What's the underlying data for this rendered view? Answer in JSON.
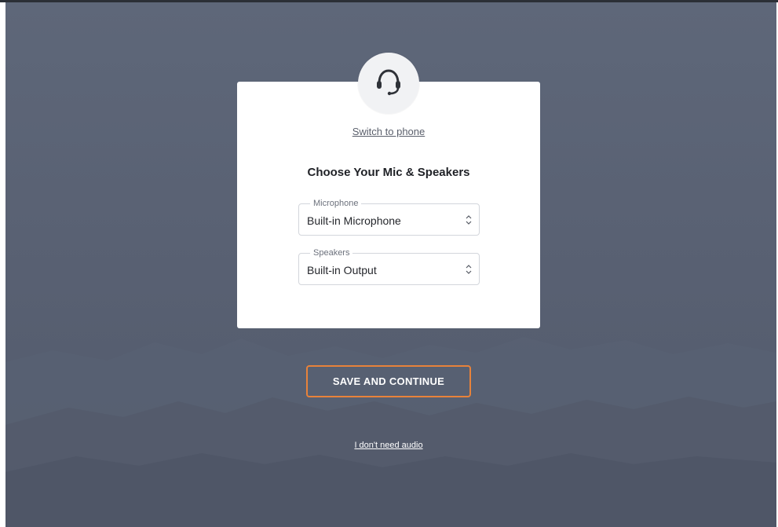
{
  "audio_setup": {
    "icon": "headset-icon",
    "switch_link": "Switch to phone",
    "title": "Choose Your Mic & Speakers",
    "microphone": {
      "legend": "Microphone",
      "value": "Built-in Microphone"
    },
    "speakers": {
      "legend": "Speakers",
      "value": "Built-in Output"
    },
    "save_button": "SAVE AND CONTINUE",
    "no_audio_link": "I don't need audio"
  },
  "colors": {
    "background": "#5a6274",
    "card": "#ffffff",
    "accent": "#e8823a"
  }
}
